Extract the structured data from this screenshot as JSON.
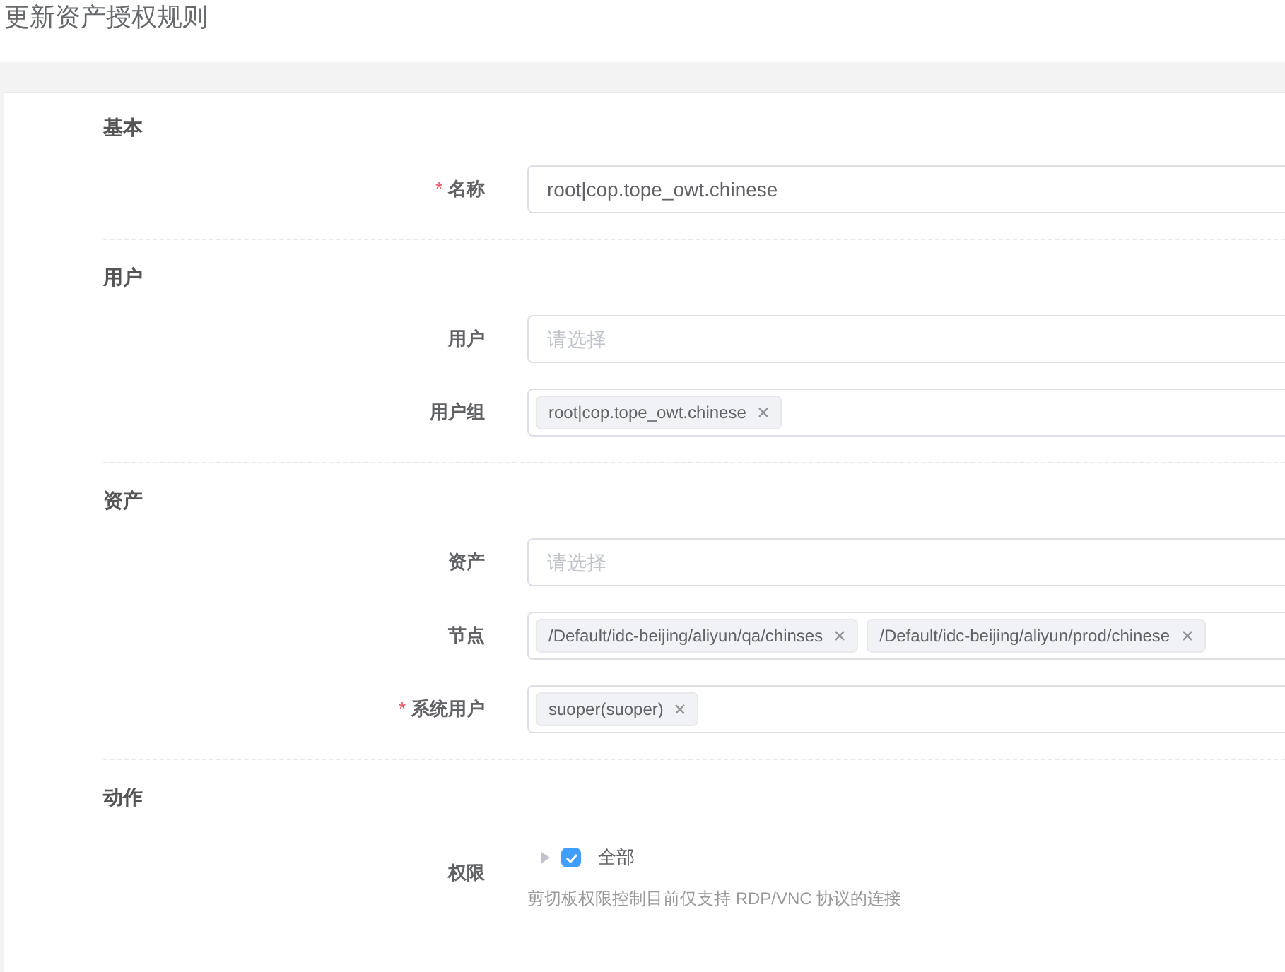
{
  "page_title": "更新资产授权规则",
  "sections": [
    {
      "title": "基本",
      "fields": [
        {
          "kind": "text",
          "label": "名称",
          "required_mark": "*",
          "value": "root|cop.tope_owt.chinese"
        }
      ]
    },
    {
      "title": "用户",
      "fields": [
        {
          "kind": "select",
          "label": "用户",
          "placeholder": "请选择"
        },
        {
          "kind": "select",
          "label": "用户组",
          "tags": [
            "root|cop.tope_owt.chinese"
          ]
        }
      ]
    },
    {
      "title": "资产",
      "fields": [
        {
          "kind": "select",
          "label": "资产",
          "placeholder": "请选择"
        },
        {
          "kind": "select",
          "label": "节点",
          "tags": [
            "/Default/idc-beijing/aliyun/qa/chinses",
            "/Default/idc-beijing/aliyun/prod/chinese"
          ]
        },
        {
          "kind": "select",
          "label": "系统用户",
          "required_mark": "*",
          "tags": [
            "suoper(suoper)"
          ]
        }
      ]
    },
    {
      "title": "动作",
      "fields": [
        {
          "kind": "tree",
          "label": "权限",
          "option": "全部",
          "checked": true,
          "expanded": false,
          "help": "剪切板权限控制目前仅支持 RDP/VNC 协议的连接"
        }
      ]
    }
  ]
}
